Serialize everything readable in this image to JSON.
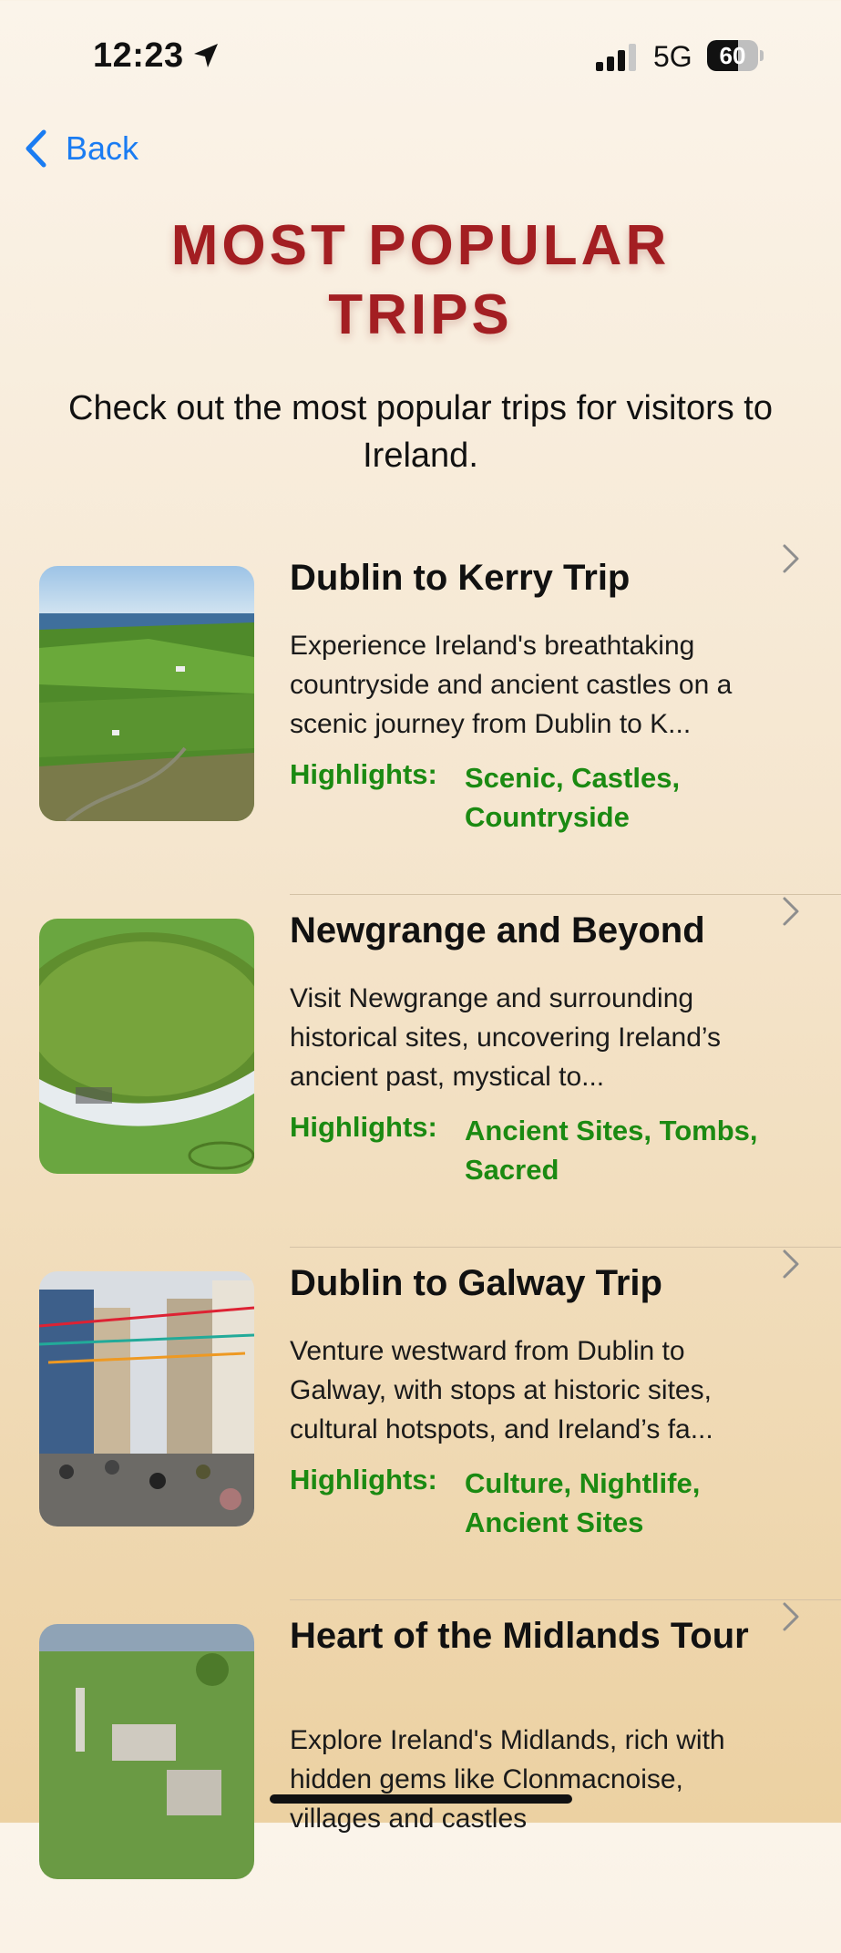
{
  "status": {
    "time": "12:23",
    "network": "5G",
    "battery": "60",
    "battery_level": 0.6
  },
  "nav": {
    "back_label": "Back"
  },
  "page": {
    "title": "MOST POPULAR TRIPS",
    "subtitle": "Check out the most popular trips for visitors to Ireland.",
    "highlights_label": "Highlights:"
  },
  "trips": [
    {
      "title": "Dublin to Kerry Trip",
      "description": "Experience Ireland's breathtaking countryside and ancient castles on a scenic journey from Dublin to K...",
      "highlights": "Scenic, Castles, Countryside"
    },
    {
      "title": "Newgrange and Beyond",
      "description": "Visit Newgrange and surrounding historical sites, uncovering Ireland’s ancient past, mystical to...",
      "highlights": "Ancient Sites, Tombs, Sacred"
    },
    {
      "title": "Dublin to Galway Trip",
      "description": "Venture westward from Dublin to Galway, with stops at historic sites, cultural hotspots, and Ireland’s fa...",
      "highlights": "Culture, Nightlife, Ancient Sites"
    },
    {
      "title": "Heart of the Midlands Tour",
      "description": "Explore Ireland's Midlands, rich with hidden gems like Clonmacnoise, villages and castles"
    }
  ],
  "colors": {
    "title": "#a31e22",
    "highlight": "#1b8a12",
    "link": "#1a7cf2"
  }
}
